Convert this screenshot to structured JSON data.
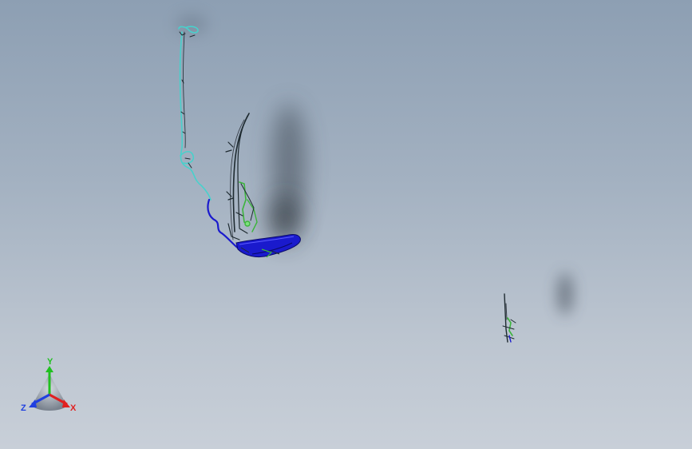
{
  "viewport": {
    "background_top": "#8d9fb3",
    "background_bottom": "#c8cfd8"
  },
  "model": {
    "colors": {
      "cable": "#48d1cc",
      "bracket": "#1a1acd",
      "mechanism": "#3cb43c",
      "linework": "#1e2a30"
    }
  },
  "triad": {
    "x_label": "X",
    "y_label": "Y",
    "z_label": "Z",
    "x_color": "#e02020",
    "y_color": "#20c020",
    "z_color": "#2040e0"
  }
}
